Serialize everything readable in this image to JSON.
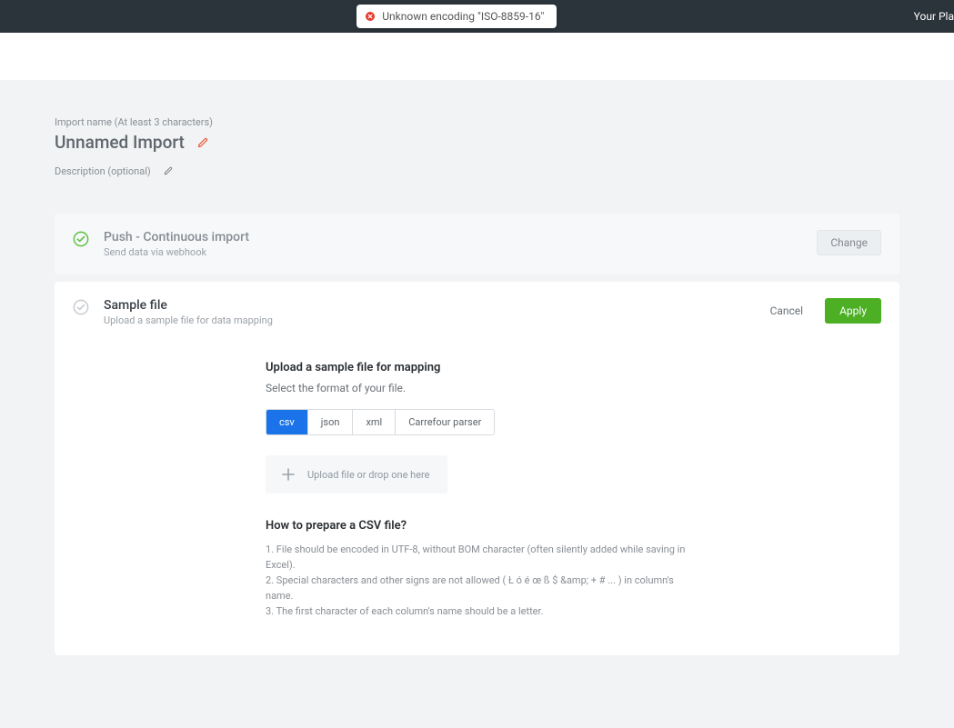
{
  "topbar": {
    "alert_text": "Unknown encoding \"ISO-8859-16\"",
    "right_label": "Your Pla"
  },
  "import": {
    "name_label": "Import name (At least 3 characters)",
    "name_value": "Unnamed Import",
    "desc_label": "Description (optional)"
  },
  "push_card": {
    "title": "Push - Continuous import",
    "subtitle": "Send data via webhook",
    "change_btn": "Change"
  },
  "sample_card": {
    "title": "Sample file",
    "subtitle": "Upload a sample file for data mapping",
    "cancel_btn": "Cancel",
    "apply_btn": "Apply"
  },
  "upload_section": {
    "heading": "Upload a sample file for mapping",
    "subtext": "Select the format of your file.",
    "tabs": [
      "csv",
      "json",
      "xml",
      "Carrefour parser"
    ],
    "upload_text": "Upload file or drop one here"
  },
  "howto": {
    "title": "How to prepare a CSV file?",
    "items": [
      "1. File should be encoded in UTF-8, without BOM character (often silently added while saving in Excel).",
      "2. Special characters and other signs are not allowed ( Ł ó é œ ß $ &amp; + # ... ) in column's name.",
      "3. The first character of each column's name should be a letter."
    ]
  }
}
